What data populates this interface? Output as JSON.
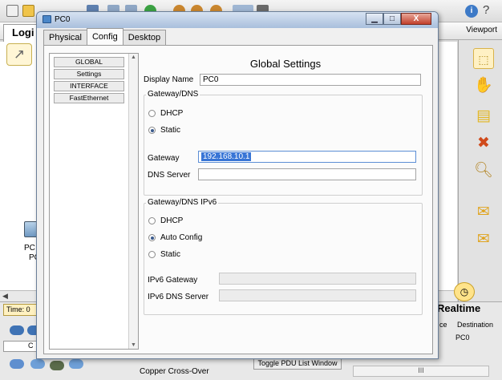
{
  "background": {
    "logical_tab": "Logi",
    "viewport_label": "Viewport",
    "time_tab": "Time: 0",
    "c_box": "C",
    "pc_label_1": "PC",
    "pc_label_2": "PC",
    "realtime_label": "Realtime",
    "pdu_headers": [
      "ce",
      "Destination"
    ],
    "pdu_row_dest": "PC0",
    "toggle_pdu": "Toggle PDU List Window",
    "cable_label": "Copper Cross-Over",
    "scroll_thumb": "III",
    "help_icon": "i"
  },
  "dialog": {
    "title": "PC0",
    "win_buttons": {
      "minimize": "▁",
      "maximize": "□",
      "close": "X"
    },
    "tabs": [
      {
        "label": "Physical",
        "active": false
      },
      {
        "label": "Config",
        "active": true
      },
      {
        "label": "Desktop",
        "active": false
      }
    ],
    "nav": [
      "GLOBAL",
      "Settings",
      "INTERFACE",
      "FastEthernet"
    ],
    "settings_title": "Global Settings",
    "display_name_label": "Display Name",
    "display_name_value": "PC0",
    "gateway_dns": {
      "group_title": "Gateway/DNS",
      "dhcp_label": "DHCP",
      "static_label": "Static",
      "selected": "Static",
      "gateway_label": "Gateway",
      "gateway_value": "192.168.10.1",
      "dns_label": "DNS Server",
      "dns_value": ""
    },
    "gateway_dns_ipv6": {
      "group_title": "Gateway/DNS IPv6",
      "dhcp_label": "DHCP",
      "auto_label": "Auto Config",
      "static_label": "Static",
      "selected": "Auto Config",
      "gateway_label": "IPv6 Gateway",
      "gateway_value": "",
      "dns_label": "IPv6 DNS Server",
      "dns_value": ""
    }
  }
}
